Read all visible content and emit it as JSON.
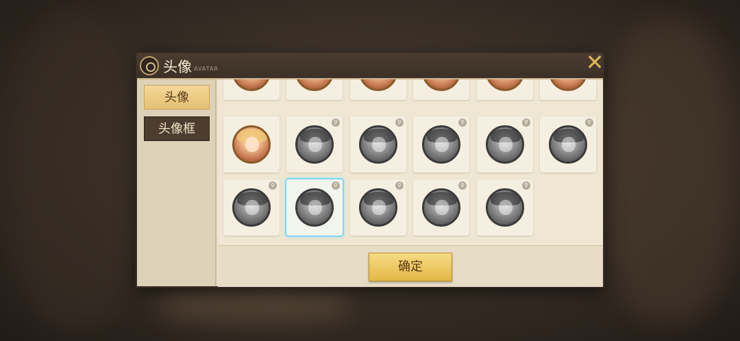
{
  "header": {
    "title": "头像",
    "subtitle": "AVATAR"
  },
  "tabs": [
    {
      "label": "头像",
      "active": true
    },
    {
      "label": "头像框",
      "active": false
    }
  ],
  "grid": {
    "rows": [
      [
        {
          "name": "avatar-partial-1",
          "unlocked": true,
          "locked": false,
          "selected": false
        },
        {
          "name": "avatar-partial-2",
          "unlocked": true,
          "locked": false,
          "selected": false
        },
        {
          "name": "avatar-partial-3",
          "unlocked": true,
          "locked": false,
          "selected": false
        },
        {
          "name": "avatar-partial-4",
          "unlocked": true,
          "locked": false,
          "selected": false
        },
        {
          "name": "avatar-partial-5",
          "unlocked": true,
          "locked": false,
          "selected": false
        },
        {
          "name": "avatar-partial-6",
          "unlocked": true,
          "locked": false,
          "selected": false
        }
      ],
      [
        {
          "name": "avatar-blonde-girl",
          "unlocked": true,
          "locked": false,
          "selected": false
        },
        {
          "name": "avatar-2",
          "unlocked": false,
          "locked": true,
          "selected": false
        },
        {
          "name": "avatar-3",
          "unlocked": false,
          "locked": true,
          "selected": false
        },
        {
          "name": "avatar-4",
          "unlocked": false,
          "locked": true,
          "selected": false
        },
        {
          "name": "avatar-5",
          "unlocked": false,
          "locked": true,
          "selected": false
        },
        {
          "name": "avatar-6",
          "unlocked": false,
          "locked": true,
          "selected": false
        }
      ],
      [
        {
          "name": "avatar-7",
          "unlocked": false,
          "locked": true,
          "selected": false
        },
        {
          "name": "avatar-8",
          "unlocked": false,
          "locked": true,
          "selected": true
        },
        {
          "name": "avatar-9",
          "unlocked": false,
          "locked": true,
          "selected": false
        },
        {
          "name": "avatar-10",
          "unlocked": false,
          "locked": true,
          "selected": false
        },
        {
          "name": "avatar-11",
          "unlocked": false,
          "locked": true,
          "selected": false
        }
      ]
    ]
  },
  "footer": {
    "confirm_label": "确定"
  },
  "icons": {
    "close": "close-icon",
    "lock": "lock-icon",
    "emblem": "emblem-icon"
  },
  "colors": {
    "accent": "#e4b745",
    "selected_glow": "#7fd7f0",
    "header_bg": "#3c3027"
  }
}
